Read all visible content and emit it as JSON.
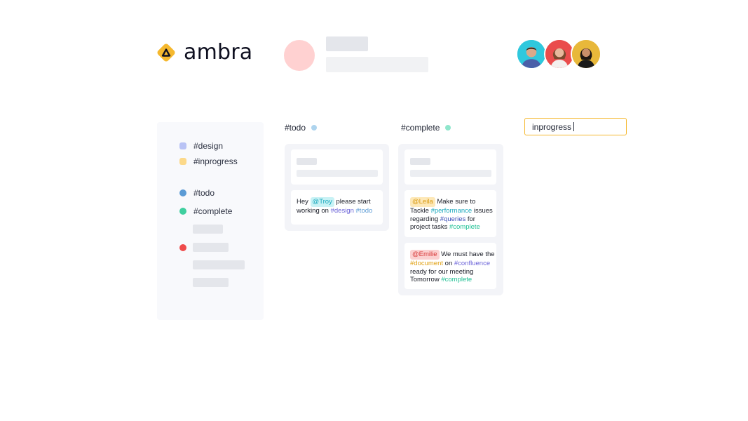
{
  "brand": {
    "name": "ambra",
    "accent": "#f5b82e"
  },
  "header": {
    "avatars": [
      "avatar-man-cyan",
      "avatar-woman-red",
      "avatar-woman-yellow"
    ]
  },
  "sidebar": {
    "tags": [
      {
        "label": "#design",
        "color": "#b9c3f5"
      },
      {
        "label": "#inprogress",
        "color": "#fcd98a"
      },
      {
        "label": "#todo",
        "color": "#5b9bd5"
      },
      {
        "label": "#complete",
        "color": "#3fcf9f"
      }
    ],
    "extra_dot_color": "#ef4b4b"
  },
  "columns": {
    "todo": {
      "title": "#todo",
      "dot_color": "#aed4ee",
      "card": {
        "pre": "Hey ",
        "mention": "@Troy",
        "mid": " please start working on ",
        "tag1": "#design",
        "space": " ",
        "tag2": "#todo"
      }
    },
    "complete": {
      "title": "#complete",
      "dot_color": "#8fe6cc",
      "card1": {
        "mention": "@Leila",
        "t1": " Make sure to Tackle ",
        "tag1": "#performance",
        "t2": " issues regarding ",
        "tag2": "#queries",
        "t3": " for project tasks ",
        "tag3": "#complete"
      },
      "card2": {
        "mention": "@Emilie",
        "t1": " We must have the ",
        "tag1": "#document",
        "t2": " on ",
        "tag2": "#confluence",
        "t3": " ready for our meeting Tomorrow ",
        "tag3": "#complete"
      }
    }
  },
  "search": {
    "value": "inprogress"
  }
}
